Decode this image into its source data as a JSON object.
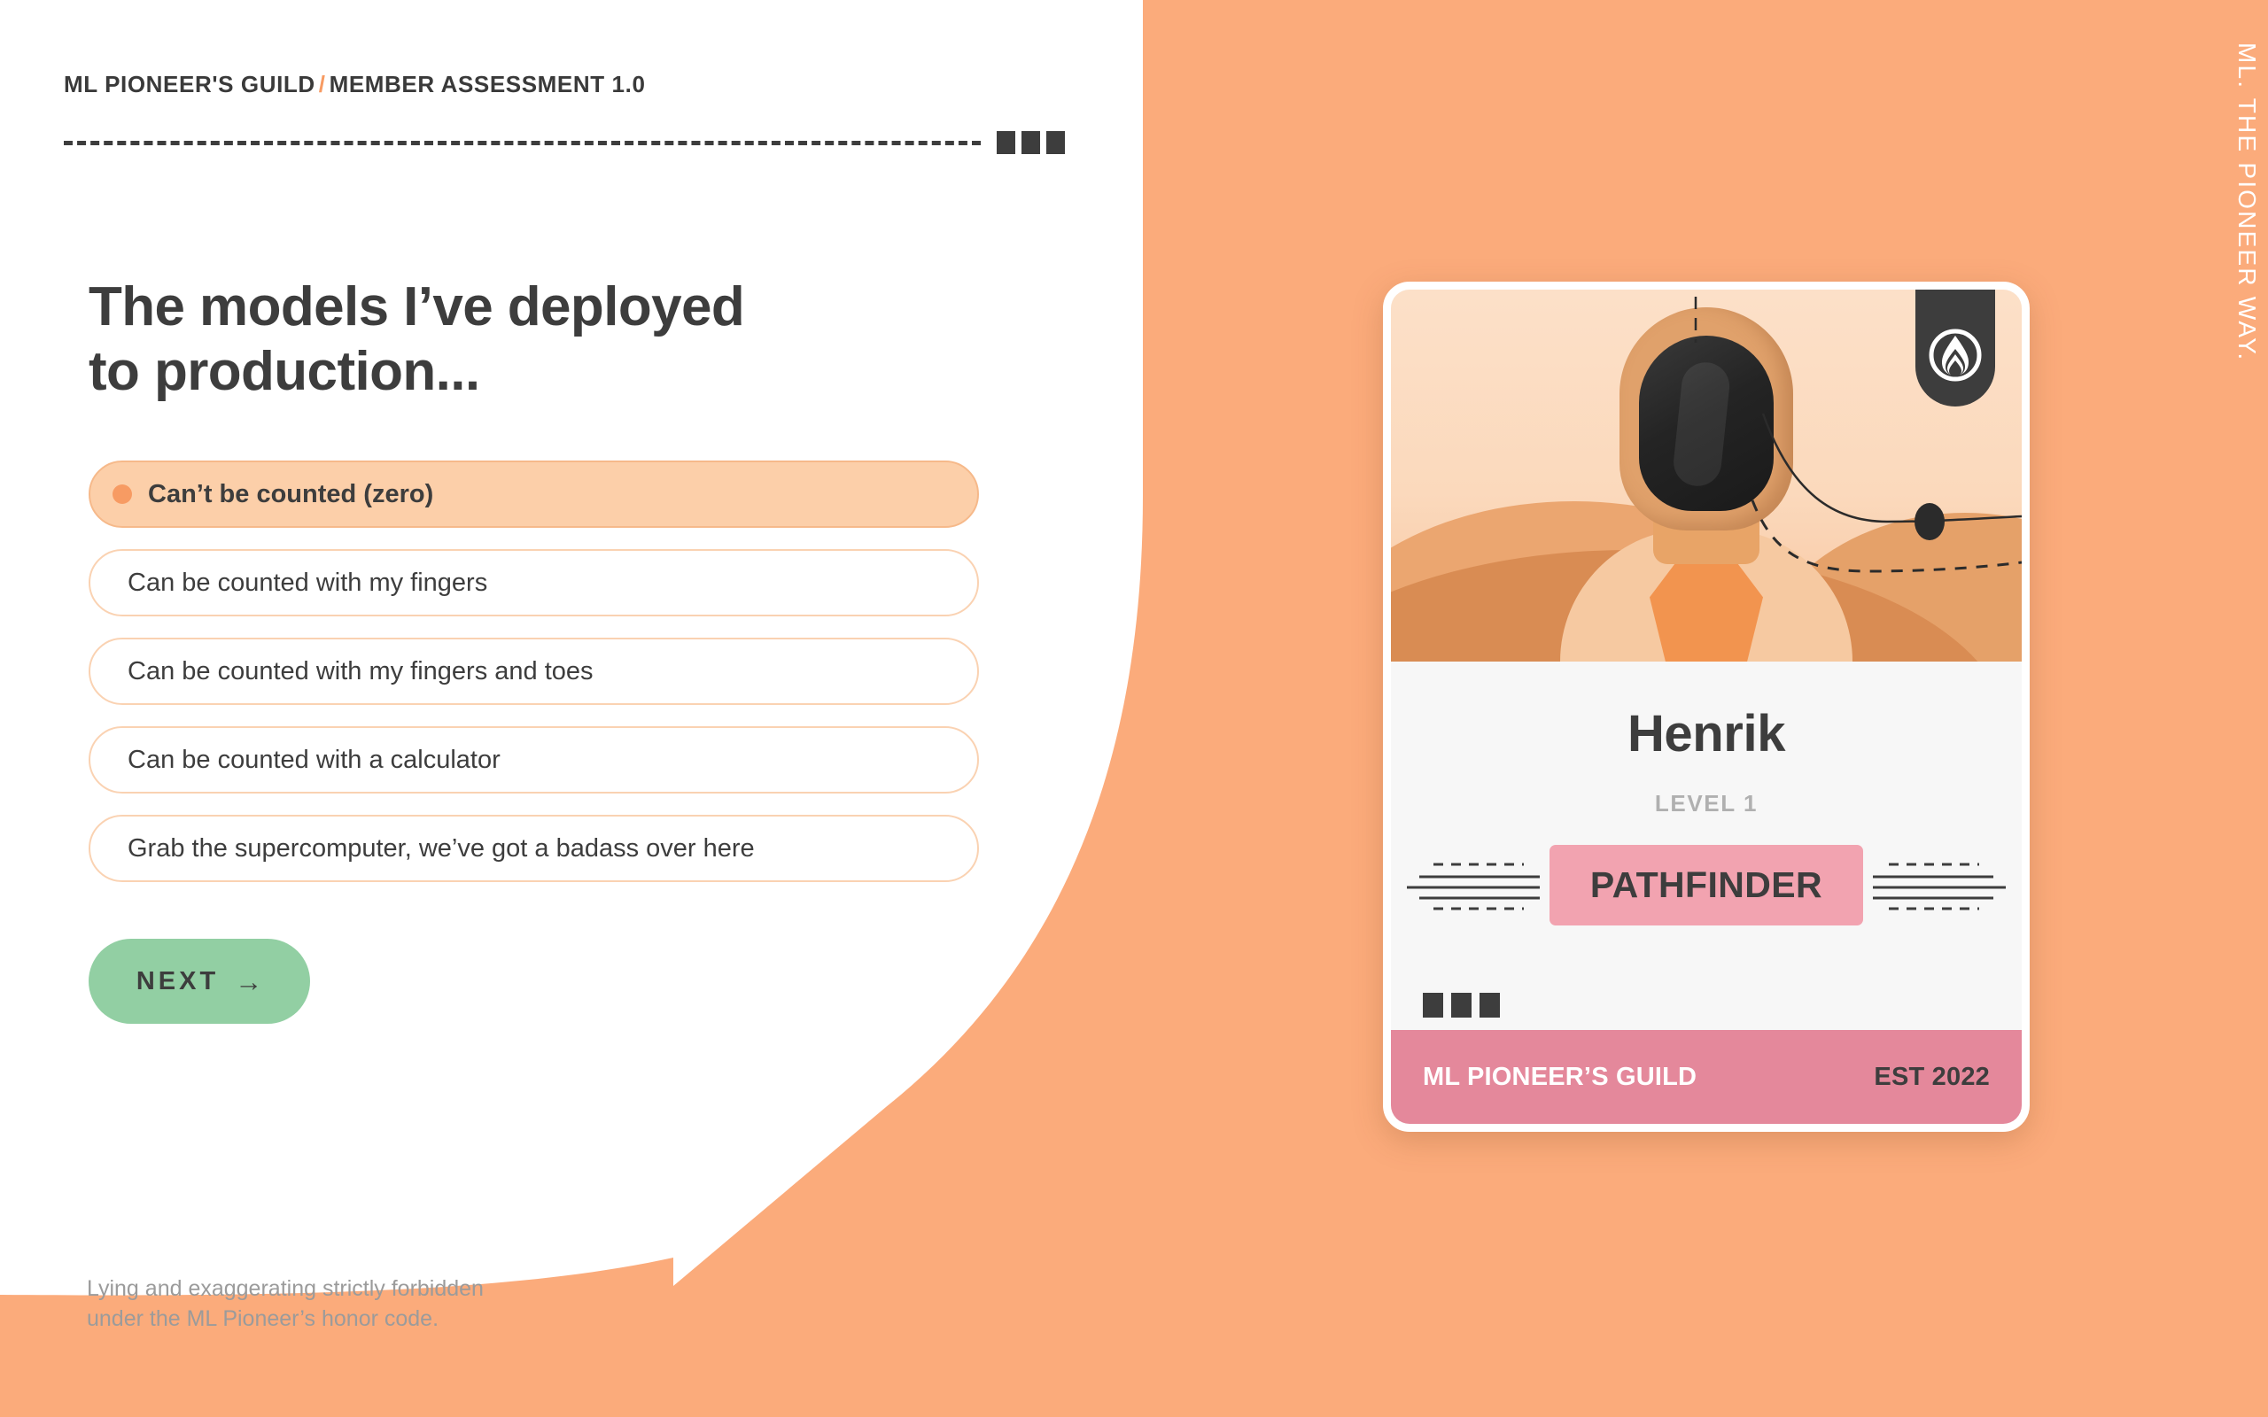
{
  "page": {
    "background_color": "#FBAB7B",
    "panel_color": "#FFFFFF"
  },
  "header": {
    "brand": "ML PIONEER'S GUILD",
    "separator": "/",
    "assessment": "MEMBER ASSESSMENT 1.0",
    "progress_squares": 3
  },
  "question": {
    "title": "The models I’ve deployed\nto production...",
    "title_line1": "The models I’ve deployed",
    "title_line2": "to production...",
    "options": [
      {
        "label": "Can’t be counted (zero)",
        "selected": true
      },
      {
        "label": "Can be counted with my fingers",
        "selected": false
      },
      {
        "label": "Can be counted with my fingers and toes",
        "selected": false
      },
      {
        "label": "Can be counted with a calculator",
        "selected": false
      },
      {
        "label": "Grab the supercomputer, we’ve got a badass over here",
        "selected": false
      }
    ]
  },
  "next_button": {
    "label": "NEXT",
    "arrow": "→",
    "color": "#92CFA3"
  },
  "footer_note": {
    "line1": "Lying and exaggerating strictly forbidden",
    "line2": "under the ML Pioneer’s honor code."
  },
  "side_tagline": "ML. THE PIONEER WAY.",
  "card": {
    "name": "Henrik",
    "level": "LEVEL 1",
    "rank": "PATHFINDER",
    "rank_color": "#F2A3B0",
    "footer_brand": "ML PIONEER’S GUILD",
    "footer_est": "EST 2022",
    "footer_color": "#E4889B",
    "logo_icon": "guild-flame-crest-icon",
    "avatar_alt": "astronaut-in-desert-illustration",
    "marker_squares": 3
  },
  "colors": {
    "accent_orange": "#FBAB7B",
    "option_selected_bg": "#FCCFA9",
    "option_border": "#FAD2B2",
    "bullet": "#F79B63",
    "ink": "#3D3D3D",
    "muted": "#9B9B9B"
  }
}
